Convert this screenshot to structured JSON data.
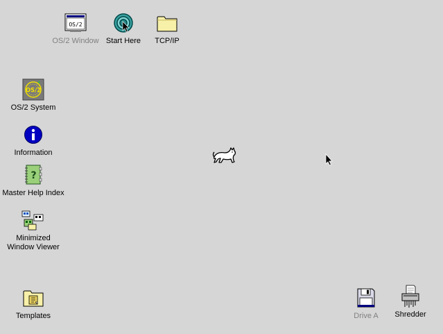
{
  "desktop": {
    "background": "#d6d6d6",
    "icons": {
      "os2_window": {
        "label": "OS/2 Window",
        "icon": "os2-window-icon",
        "disabled": true
      },
      "start_here": {
        "label": "Start Here",
        "icon": "start-here-icon"
      },
      "tcpip": {
        "label": "TCP/IP",
        "icon": "folder-icon"
      },
      "os2_system": {
        "label": "OS/2 System",
        "icon": "os2-system-icon"
      },
      "information": {
        "label": "Information",
        "icon": "information-icon"
      },
      "master_help": {
        "label": "Master Help Index",
        "icon": "help-book-icon"
      },
      "minimized_viewer": {
        "label": "Minimized\nWindow Viewer",
        "icon": "minimized-windows-icon"
      },
      "templates": {
        "label": "Templates",
        "icon": "templates-folder-icon"
      },
      "drive_a": {
        "label": "Drive A",
        "icon": "floppy-disk-icon",
        "disabled": true
      },
      "shredder": {
        "label": "Shredder",
        "icon": "shredder-icon"
      }
    }
  },
  "colors": {
    "folder": "#f7f0a8",
    "info_blue": "#0000c0",
    "help_green": "#9ad07a",
    "disabled_text": "#808080"
  }
}
